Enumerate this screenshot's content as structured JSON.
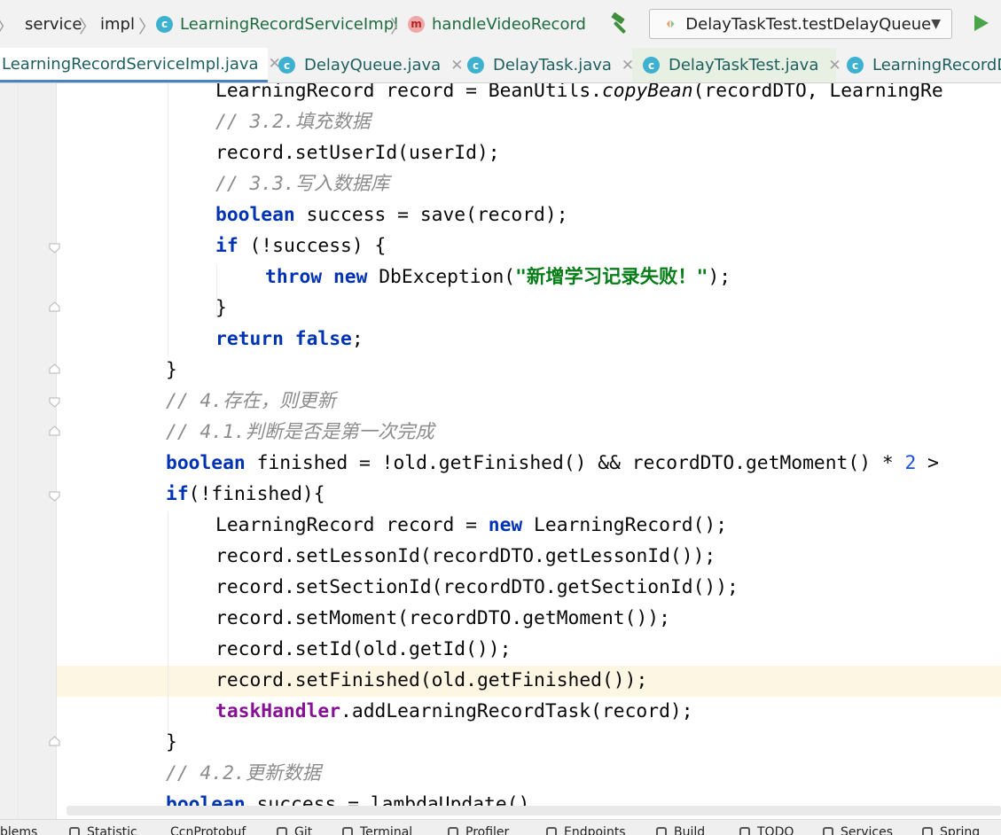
{
  "breadcrumb": {
    "items": [
      "service",
      "impl",
      "LearningRecordServiceImpl",
      "handleVideoRecord"
    ]
  },
  "run_config": {
    "label": "DelayTaskTest.testDelayQueue"
  },
  "tabs": [
    {
      "label": "LearningRecordServiceImpl.java",
      "icon": "class-icon",
      "active": true
    },
    {
      "label": "DelayQueue.java",
      "icon": "class-icon"
    },
    {
      "label": "DelayTask.java",
      "icon": "class-icon"
    },
    {
      "label": "DelayTaskTest.java",
      "icon": "test-class-icon"
    },
    {
      "label": "LearningRecordD",
      "icon": "class-icon"
    }
  ],
  "code_lines": [
    "LearningRecord record = BeanUtils.copyBean(recordDTO, LearningRe",
    "// 3.2.填充数据",
    "record.setUserId(userId);",
    "// 3.3.写入数据库",
    "boolean success = save(record);",
    "if (!success) {",
    "throw new DbException(\"新增学习记录失败！\");",
    "}",
    "return false;",
    "}",
    "// 4.存在，则更新",
    "// 4.1.判断是否是第一次完成",
    "boolean finished = !old.getFinished() && recordDTO.getMoment() * 2 >",
    "if(!finished){",
    "LearningRecord record = new LearningRecord();",
    "record.setLessonId(recordDTO.getLessonId());",
    "record.setSectionId(recordDTO.getSectionId());",
    "record.setMoment(recordDTO.getMoment());",
    "record.setId(old.getId());",
    "record.setFinished(old.getFinished());",
    "taskHandler.addLearningRecordTask(record);",
    "}",
    "// 4.2.更新数据",
    "boolean success = lambdaUpdate()"
  ],
  "tool_windows": [
    "blems",
    "Statistic",
    "CcnProtobuf",
    "Git",
    "Terminal",
    "Profiler",
    "Endpoints",
    "Build",
    "TODO",
    "Services",
    "Spring"
  ],
  "colors": {
    "keyword": "#0033b3",
    "comment": "#8c8c8c",
    "string": "#067d17",
    "field": "#871094",
    "caret_line": "#fcf6e3",
    "active_tab_underline": "#4a83c2"
  }
}
